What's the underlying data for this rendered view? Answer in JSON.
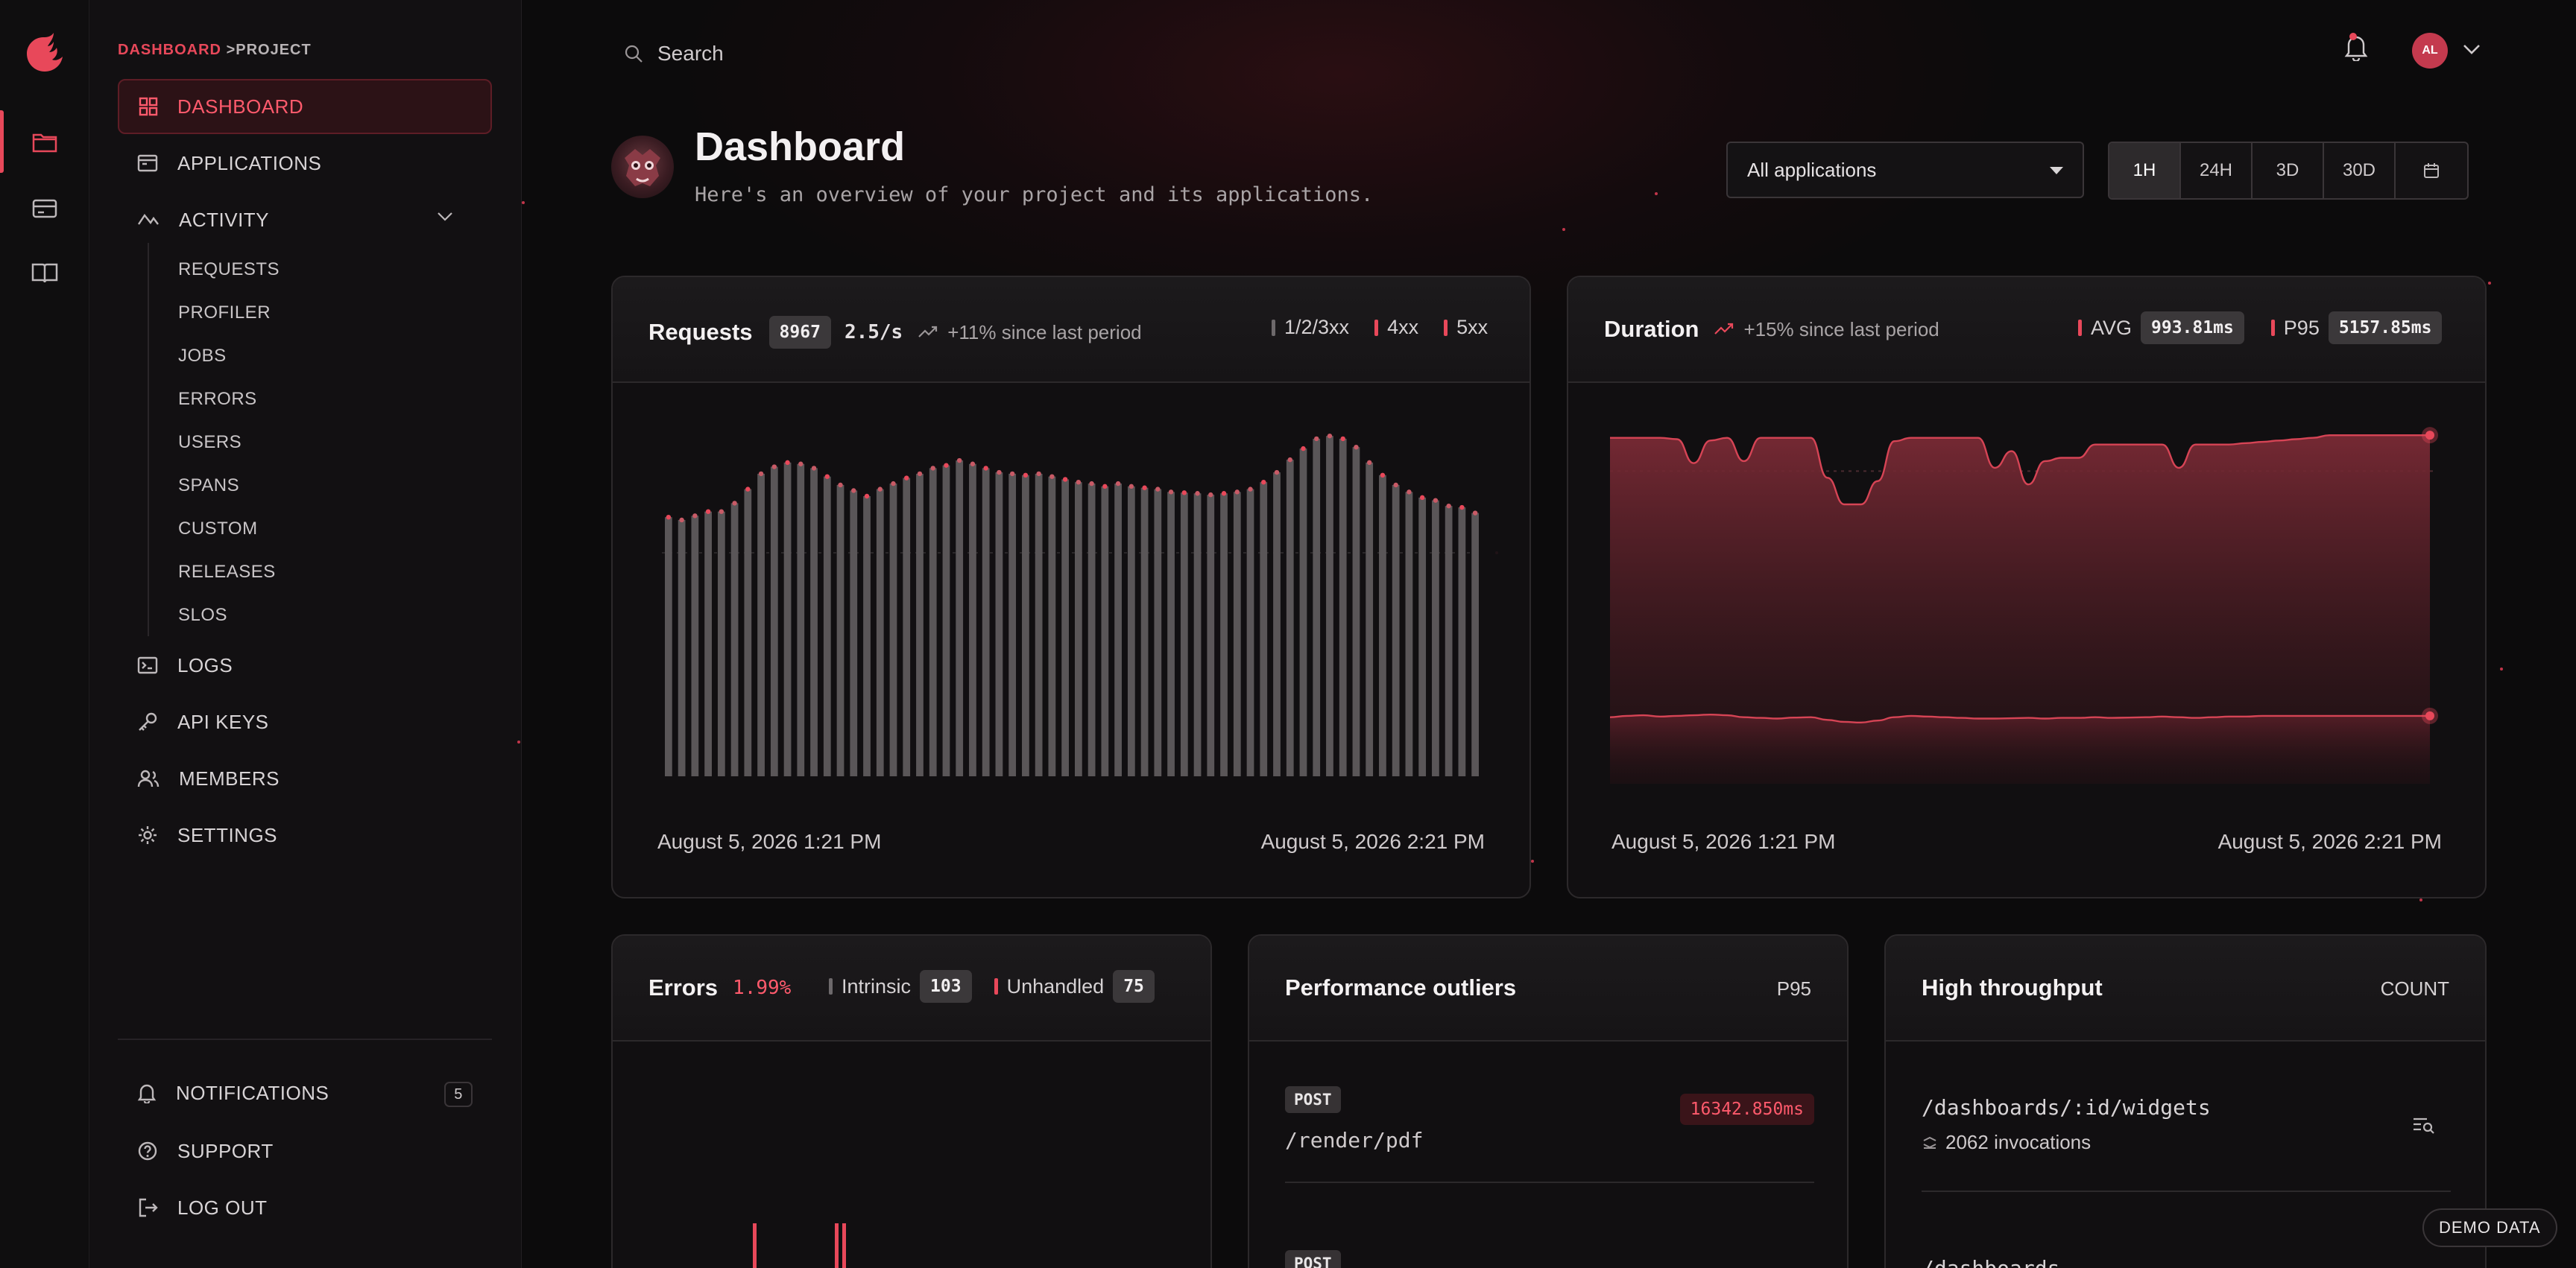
{
  "breadcrumb": {
    "root": "DASHBOARD",
    "sep": ">",
    "current": "PROJECT"
  },
  "search": {
    "placeholder": "Search"
  },
  "user": {
    "initials": "AL"
  },
  "sidebar": {
    "items": [
      {
        "label": "DASHBOARD",
        "icon": "grid-icon"
      },
      {
        "label": "APPLICATIONS",
        "icon": "window-icon"
      },
      {
        "label": "ACTIVITY",
        "icon": "activity-icon"
      },
      {
        "label": "LOGS",
        "icon": "terminal-icon"
      },
      {
        "label": "API KEYS",
        "icon": "key-icon"
      },
      {
        "label": "MEMBERS",
        "icon": "users-icon"
      },
      {
        "label": "SETTINGS",
        "icon": "gear-icon"
      }
    ],
    "activity_sub": [
      "REQUESTS",
      "PROFILER",
      "JOBS",
      "ERRORS",
      "USERS",
      "SPANS",
      "CUSTOM",
      "RELEASES",
      "SLOS"
    ],
    "bottom": [
      {
        "label": "NOTIFICATIONS",
        "icon": "bell-icon",
        "count": "5"
      },
      {
        "label": "SUPPORT",
        "icon": "help-icon"
      },
      {
        "label": "LOG OUT",
        "icon": "logout-icon"
      }
    ]
  },
  "header": {
    "title": "Dashboard",
    "subtitle": "Here's an overview of your project and its applications.",
    "app_select": "All applications",
    "ranges": [
      "1H",
      "24H",
      "3D",
      "30D"
    ],
    "active_range": "1H"
  },
  "requests": {
    "title": "Requests",
    "total": "8967",
    "rate": "2.5/s",
    "change": "+11% since last period",
    "legend": [
      "1/2/3xx",
      "4xx",
      "5xx"
    ],
    "start": "August 5, 2026 1:21 PM",
    "end": "August 5, 2026 2:21 PM"
  },
  "duration": {
    "title": "Duration",
    "change": "+15% since last period",
    "avg_label": "AVG",
    "avg_value": "993.81ms",
    "p95_label": "P95",
    "p95_value": "5157.85ms",
    "start": "August 5, 2026 1:21 PM",
    "end": "August 5, 2026 2:21 PM"
  },
  "errors": {
    "title": "Errors",
    "rate": "1.99%",
    "intrinsic_label": "Intrinsic",
    "intrinsic": "103",
    "unhandled_label": "Unhandled",
    "unhandled": "75"
  },
  "outliers": {
    "title": "Performance outliers",
    "metric": "P95",
    "rows": [
      {
        "method": "POST",
        "path": "/render/pdf",
        "value": "16342.850ms"
      },
      {
        "method": "POST",
        "path": "",
        "value": ""
      }
    ]
  },
  "throughput": {
    "title": "High throughput",
    "metric": "COUNT",
    "rows": [
      {
        "path": "/dashboards/:id/widgets",
        "invocations": "2062 invocations"
      },
      {
        "path": "/dashboards",
        "invocations": ""
      }
    ]
  },
  "demo_label": "DEMO DATA",
  "colors": {
    "accent": "#e8485a",
    "bar": "#5a5658",
    "bg": "#0d0c0d"
  },
  "chart_data": [
    {
      "type": "bar",
      "title": "Requests",
      "values": [
        370,
        366,
        372,
        378,
        378,
        390,
        410,
        432,
        442,
        448,
        446,
        440,
        428,
        416,
        408,
        400,
        410,
        418,
        426,
        432,
        440,
        444,
        451,
        446,
        440,
        434,
        432,
        430,
        432,
        428,
        424,
        420,
        418,
        414,
        418,
        414,
        412,
        410,
        406,
        405,
        404,
        402,
        404,
        406,
        410,
        420,
        434,
        452,
        468,
        482,
        486,
        482,
        470,
        448,
        430,
        416,
        406,
        398,
        394,
        386,
        384,
        376
      ],
      "markers": "colored dots indicate 4xx/5xx responses",
      "ylim": [
        0,
        500
      ]
    },
    {
      "type": "area",
      "title": "Duration",
      "series": [
        {
          "name": "P95",
          "values": [
            5200,
            5200,
            5200,
            5200,
            5180,
            4820,
            5160,
            5200,
            4850,
            5200,
            5200,
            5200,
            5200,
            4600,
            4200,
            4200,
            4550,
            5150,
            5200,
            5200,
            5200,
            5200,
            5200,
            4750,
            5000,
            4500,
            4850,
            4900,
            4900,
            5100,
            5100,
            5100,
            5100,
            5100,
            4750,
            5100,
            5100,
            5100,
            5120,
            5140,
            5160,
            5180,
            5200,
            5240,
            5240,
            5240,
            5240,
            5240,
            5240,
            5240
          ]
        },
        {
          "name": "AVG",
          "values": [
            1000,
            1020,
            1030,
            1010,
            1020,
            1030,
            1040,
            1030,
            1000,
            990,
            980,
            995,
            1000,
            960,
            930,
            920,
            950,
            1000,
            1020,
            1010,
            1000,
            990,
            980,
            980,
            985,
            990,
            980,
            990,
            990,
            1000,
            990,
            995,
            1000,
            1010,
            1000,
            990,
            1000,
            1010,
            1010,
            1020,
            1020,
            1020,
            1020,
            1020,
            1020,
            1020,
            1020,
            1020,
            1020,
            1020
          ]
        }
      ],
      "ylim": [
        0,
        5600
      ]
    }
  ]
}
